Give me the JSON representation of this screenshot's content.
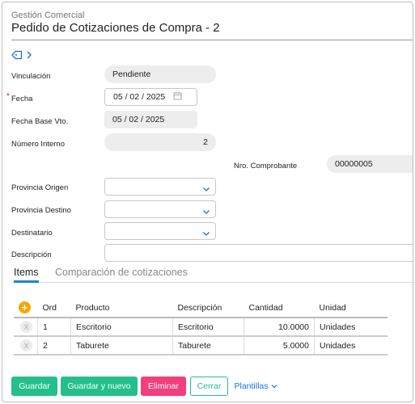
{
  "header": {
    "subtitle": "Gestión Comercial",
    "title": "Pedido de Cotizaciones de Compra - 2"
  },
  "fields": {
    "vinculacion": {
      "label": "Vinculación",
      "value": "Pendiente"
    },
    "fecha": {
      "label": "Fecha",
      "required_mark": "*",
      "value": "05 / 02 / 2025"
    },
    "fecha_base": {
      "label": "Fecha Base Vto.",
      "value": "05 / 02 / 2025"
    },
    "numero_interno": {
      "label": "Número Interno",
      "value": "2"
    },
    "nro_comprobante": {
      "label": "Nro. Comprobante",
      "value": "00000005"
    },
    "provincia_origen": {
      "label": "Provincia Origen",
      "value": ""
    },
    "provincia_destino": {
      "label": "Provincia Destino",
      "value": ""
    },
    "destinatario": {
      "label": "Destinatario",
      "value": ""
    },
    "descripcion": {
      "label": "Descripción",
      "value": ""
    }
  },
  "tabs": [
    {
      "label": "Items",
      "active": true
    },
    {
      "label": "Comparación de cotizaciones",
      "active": false
    }
  ],
  "grid": {
    "add_icon": "+",
    "delete_icon": "X",
    "columns": [
      "Ord",
      "Producto",
      "Descripción",
      "Cantidad",
      "Unidad"
    ],
    "rows": [
      {
        "ord": "1",
        "producto": "Escritorio",
        "descripcion": "Escritorio",
        "cantidad": "10.0000",
        "unidad": "Unidades"
      },
      {
        "ord": "2",
        "producto": "Taburete",
        "descripcion": "Taburete",
        "cantidad": "5.0000",
        "unidad": "Unidades"
      }
    ]
  },
  "actions": {
    "guardar": "Guardar",
    "guardar_nuevo": "Guardar y nuevo",
    "eliminar": "Eliminar",
    "cerrar": "Cerrar",
    "plantillas": "Plantillas"
  },
  "colors": {
    "primary": "#25c08a",
    "danger": "#f23f7d",
    "accent": "#1e88c7",
    "link": "#1a6fd8",
    "add": "#f6a800"
  }
}
